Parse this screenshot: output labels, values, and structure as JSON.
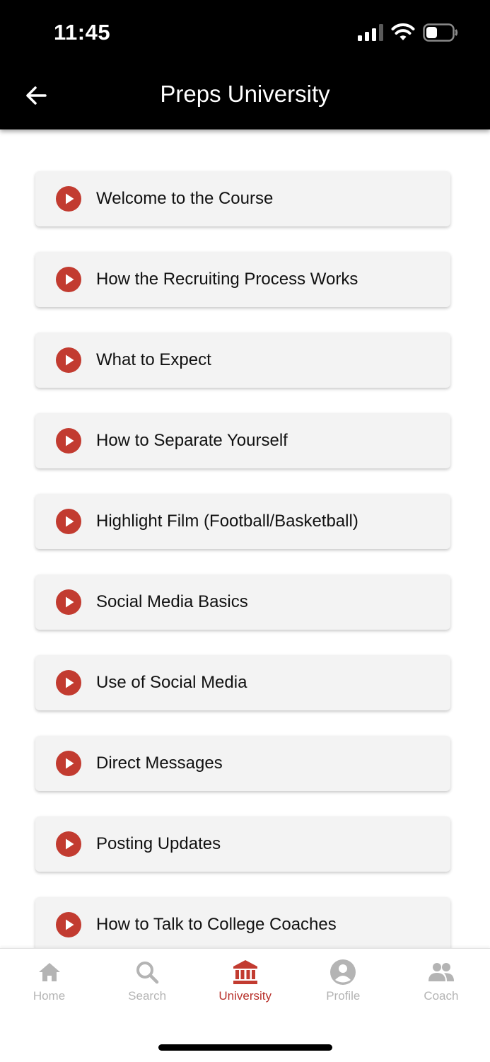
{
  "status": {
    "time": "11:45"
  },
  "header": {
    "title": "Preps University",
    "back_icon": "arrow-left-icon"
  },
  "colors": {
    "accent": "#c23b30",
    "header_bg": "#000000",
    "card_bg": "#f3f3f3",
    "tab_inactive": "#b4b4b4"
  },
  "lessons": [
    {
      "label": "Welcome to the Course",
      "icon": "play-circle-icon"
    },
    {
      "label": "How the Recruiting Process Works",
      "icon": "play-circle-icon"
    },
    {
      "label": "What to Expect",
      "icon": "play-circle-icon"
    },
    {
      "label": "How to Separate Yourself",
      "icon": "play-circle-icon"
    },
    {
      "label": "Highlight Film (Football/Basketball)",
      "icon": "play-circle-icon"
    },
    {
      "label": "Social Media Basics",
      "icon": "play-circle-icon"
    },
    {
      "label": "Use of Social Media",
      "icon": "play-circle-icon"
    },
    {
      "label": "Direct Messages",
      "icon": "play-circle-icon"
    },
    {
      "label": "Posting Updates",
      "icon": "play-circle-icon"
    },
    {
      "label": "How to Talk to College Coaches",
      "icon": "play-circle-icon"
    }
  ],
  "tabs": [
    {
      "label": "Home",
      "icon": "home-icon",
      "active": false
    },
    {
      "label": "Search",
      "icon": "search-icon",
      "active": false
    },
    {
      "label": "University",
      "icon": "university-icon",
      "active": true
    },
    {
      "label": "Profile",
      "icon": "profile-icon",
      "active": false
    },
    {
      "label": "Coach",
      "icon": "coach-icon",
      "active": false
    }
  ]
}
